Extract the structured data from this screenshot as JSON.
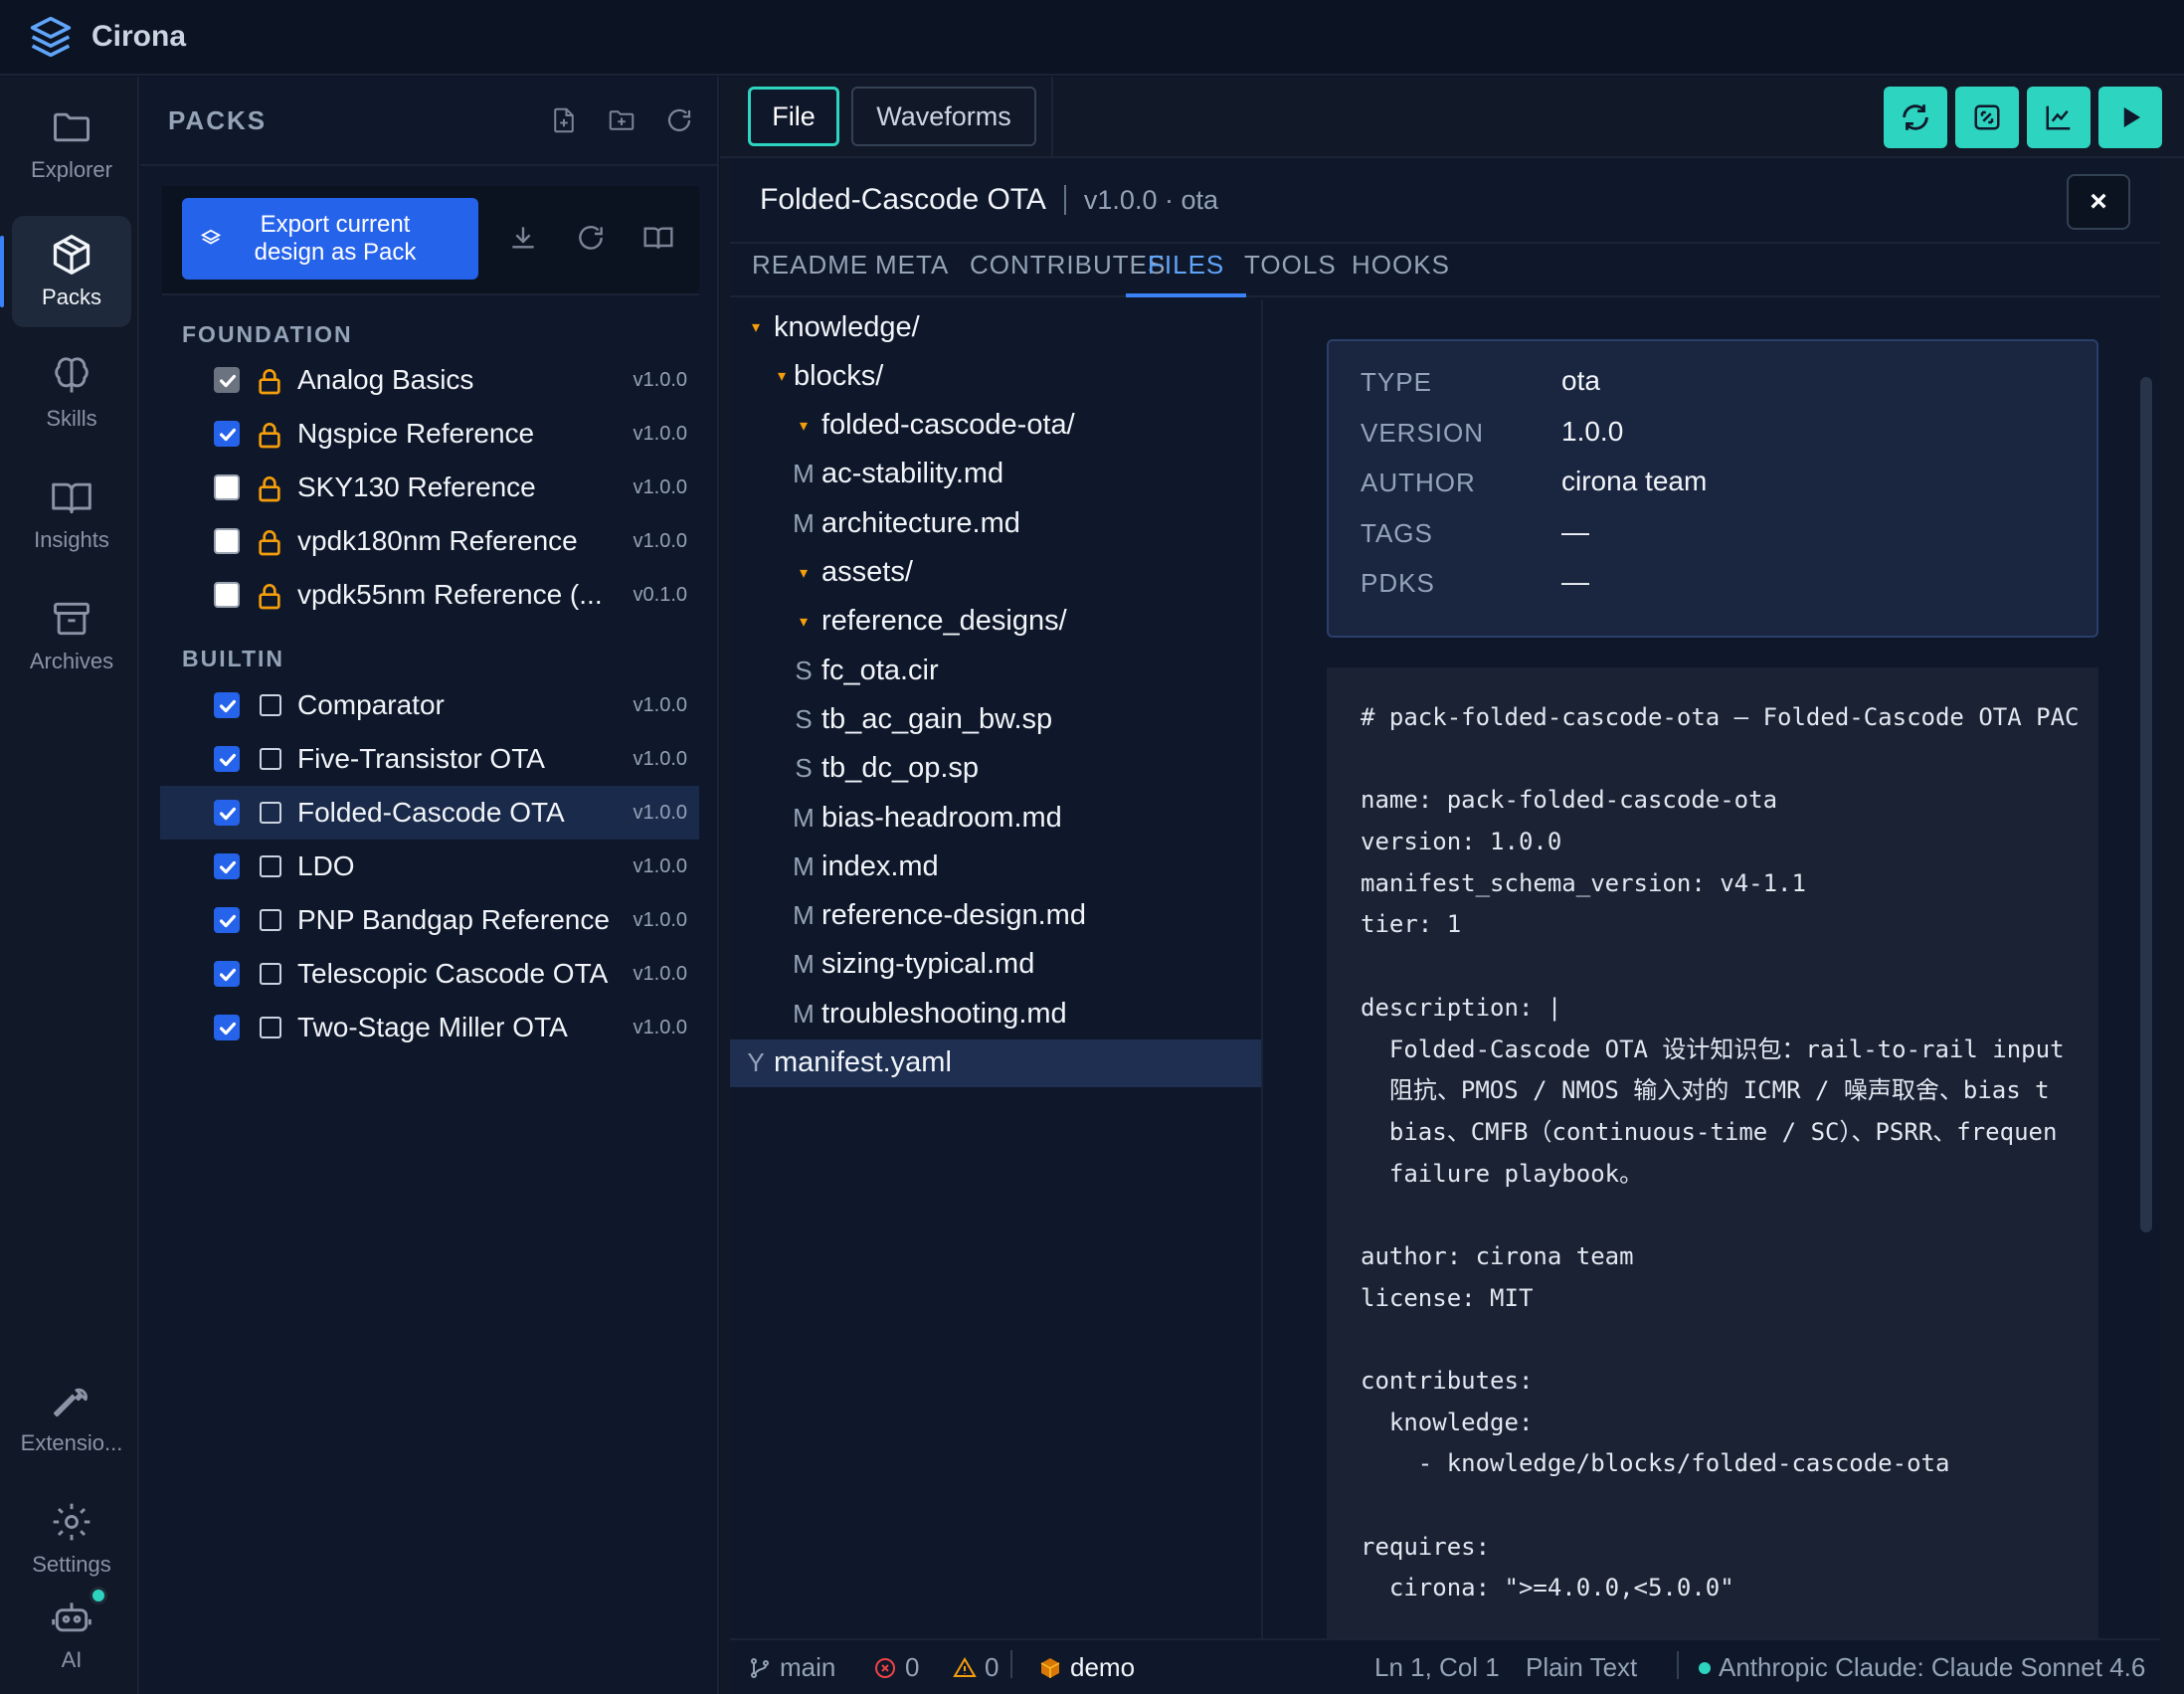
{
  "app": {
    "name": "Cirona"
  },
  "activity_bar": [
    {
      "label": "Explorer",
      "icon": "folder-icon"
    },
    {
      "label": "Packs",
      "icon": "package-icon",
      "active": true
    },
    {
      "label": "Skills",
      "icon": "brain-icon"
    },
    {
      "label": "Insights",
      "icon": "book-icon"
    },
    {
      "label": "Archives",
      "icon": "archive-icon"
    },
    {
      "label": "Extensio...",
      "icon": "wrench-icon"
    },
    {
      "label": "Settings",
      "icon": "gear-icon"
    },
    {
      "label": "AI",
      "icon": "robot-icon"
    }
  ],
  "packs_panel": {
    "title": "PACKS",
    "export_label": "Export current design as Pack",
    "groups": [
      {
        "label": "FOUNDATION",
        "items": [
          {
            "name": "Analog Basics",
            "version": "v1.0.0",
            "checked": true,
            "disabled": true,
            "locked": true
          },
          {
            "name": "Ngspice Reference",
            "version": "v1.0.0",
            "checked": true,
            "locked": true
          },
          {
            "name": "SKY130 Reference",
            "version": "v1.0.0",
            "checked": false,
            "locked": true
          },
          {
            "name": "vpdk180nm Reference",
            "version": "v1.0.0",
            "checked": false,
            "locked": true
          },
          {
            "name": "vpdk55nm Reference (...",
            "version": "v0.1.0",
            "checked": false,
            "locked": true
          }
        ]
      },
      {
        "label": "BUILTIN",
        "items": [
          {
            "name": "Comparator",
            "version": "v1.0.0",
            "checked": true
          },
          {
            "name": "Five-Transistor OTA",
            "version": "v1.0.0",
            "checked": true
          },
          {
            "name": "Folded-Cascode OTA",
            "version": "v1.0.0",
            "checked": true,
            "selected": true
          },
          {
            "name": "LDO",
            "version": "v1.0.0",
            "checked": true
          },
          {
            "name": "PNP Bandgap Reference",
            "version": "v1.0.0",
            "checked": true
          },
          {
            "name": "Telescopic Cascode OTA",
            "version": "v1.0.0",
            "checked": true
          },
          {
            "name": "Two-Stage Miller OTA",
            "version": "v1.0.0",
            "checked": true
          }
        ]
      }
    ]
  },
  "top_tabs": [
    {
      "label": "File",
      "active": true
    },
    {
      "label": "Waveforms"
    }
  ],
  "toolbar_actions": [
    "refresh-icon",
    "fit-icon",
    "chart-icon",
    "play-icon"
  ],
  "detail": {
    "title": "Folded-Cascode OTA",
    "subtitle": "v1.0.0 · ota",
    "close_label": "×",
    "tabs": [
      "README",
      "META",
      "CONTRIBUTES",
      "FILES",
      "TOOLS",
      "HOOKS"
    ],
    "active_tab": "FILES",
    "files": [
      {
        "mark": "▾",
        "name": "knowledge/",
        "depth": 0,
        "arrow": true
      },
      {
        "mark": "▾",
        "name": "blocks/",
        "depth": 1,
        "arrow": true
      },
      {
        "mark": "▾",
        "name": "folded-cascode-ota/",
        "depth": 2,
        "arrow": true
      },
      {
        "mark": "M",
        "name": "ac-stability.md",
        "depth": 2
      },
      {
        "mark": "M",
        "name": "architecture.md",
        "depth": 2
      },
      {
        "mark": "▾",
        "name": "assets/",
        "depth": 2,
        "arrow": true
      },
      {
        "mark": "▾",
        "name": "reference_designs/",
        "depth": 2,
        "arrow": true
      },
      {
        "mark": "S",
        "name": "fc_ota.cir",
        "depth": 2
      },
      {
        "mark": "S",
        "name": "tb_ac_gain_bw.sp",
        "depth": 2
      },
      {
        "mark": "S",
        "name": "tb_dc_op.sp",
        "depth": 2
      },
      {
        "mark": "M",
        "name": "bias-headroom.md",
        "depth": 2
      },
      {
        "mark": "M",
        "name": "index.md",
        "depth": 2
      },
      {
        "mark": "M",
        "name": "reference-design.md",
        "depth": 2
      },
      {
        "mark": "M",
        "name": "sizing-typical.md",
        "depth": 2
      },
      {
        "mark": "M",
        "name": "troubleshooting.md",
        "depth": 2
      },
      {
        "mark": "Y",
        "name": "manifest.yaml",
        "depth": 0,
        "selected": true
      }
    ],
    "meta": [
      {
        "key": "TYPE",
        "value": "ota"
      },
      {
        "key": "VERSION",
        "value": "1.0.0"
      },
      {
        "key": "AUTHOR",
        "value": "cirona team"
      },
      {
        "key": "TAGS",
        "value": "—"
      },
      {
        "key": "PDKS",
        "value": "—"
      }
    ],
    "code_lines": [
      "# pack-folded-cascode-ota — Folded-Cascode OTA PAC",
      "",
      "name: pack-folded-cascode-ota",
      "version: 1.0.0",
      "manifest_schema_version: v4-1.1",
      "tier: 1",
      "",
      "description: |",
      "  Folded-Cascode OTA 设计知识包：rail-to-rail input",
      "  阻抗、PMOS / NMOS 输入对的 ICMR / 噪声取舍、bias t",
      "  bias、CMFB（continuous-time / SC）、PSRR、frequen",
      "  failure playbook。",
      "",
      "author: cirona team",
      "license: MIT",
      "",
      "contributes:",
      "  knowledge:",
      "    - knowledge/blocks/folded-cascode-ota",
      "",
      "requires:",
      "  cirona: \">=4.0.0,<5.0.0\""
    ]
  },
  "status": {
    "branch": "main",
    "errors": "0",
    "warnings": "0",
    "project": "demo",
    "position": "Ln 1, Col 1",
    "language": "Plain Text",
    "model": "Anthropic Claude: Claude Sonnet 4.6"
  }
}
